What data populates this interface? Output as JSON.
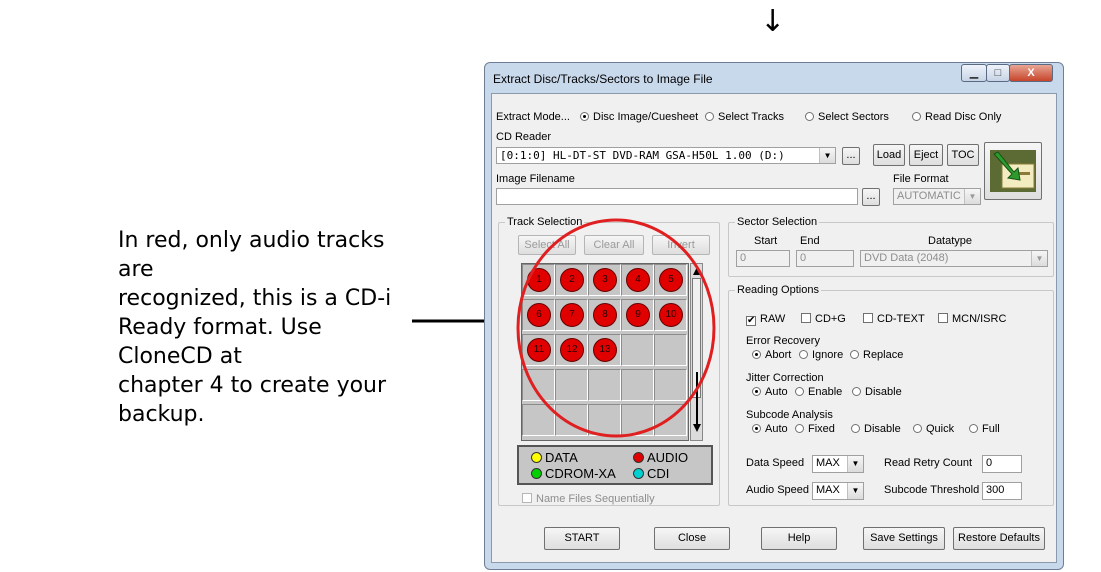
{
  "annotation": {
    "text": "In red, only audio tracks are\nrecognized, this is a CD-i\nReady format. Use CloneCD at\nchapter 4 to create your\nbackup.",
    "arrow_down": "↓"
  },
  "window": {
    "title": "Extract Disc/Tracks/Sectors to Image File",
    "minimize": "▁",
    "maximize": "□",
    "close": "X"
  },
  "extract_mode": {
    "label": "Extract Mode...",
    "options": [
      "Disc Image/Cuesheet",
      "Select Tracks",
      "Select Sectors",
      "Read Disc Only"
    ],
    "selected": "Disc Image/Cuesheet"
  },
  "cd_reader": {
    "label": "CD Reader",
    "value": "[0:1:0] HL-DT-ST DVD-RAM GSA-H50L 1.00 (D:)",
    "browse": "...",
    "load": "Load",
    "eject": "Eject",
    "toc": "TOC"
  },
  "image_filename": {
    "label": "Image Filename",
    "value": "",
    "browse": "..."
  },
  "file_format": {
    "label": "File Format",
    "value": "AUTOMATIC"
  },
  "track_selection": {
    "title": "Track Selection",
    "select_all": "Select All",
    "clear_all": "Clear All",
    "invert": "Invert",
    "tracks": [
      "1",
      "2",
      "3",
      "4",
      "5",
      "6",
      "7",
      "8",
      "9",
      "10",
      "11",
      "12",
      "13"
    ],
    "legend": {
      "data": "DATA",
      "audio": "AUDIO",
      "cdrom_xa": "CDROM-XA",
      "cdi": "CDI"
    },
    "colors": {
      "data": "#ffff00",
      "audio": "#e00000",
      "cdrom_xa": "#00d000",
      "cdi": "#00d0d0"
    },
    "name_files_sequentially": "Name Files Sequentially"
  },
  "sector_selection": {
    "title": "Sector Selection",
    "start_label": "Start",
    "end_label": "End",
    "datatype_label": "Datatype",
    "start_value": "0",
    "end_value": "0",
    "datatype_value": "DVD Data (2048)"
  },
  "reading_options": {
    "title": "Reading Options",
    "raw": "RAW",
    "cdg": "CD+G",
    "cdtext": "CD-TEXT",
    "mcn": "MCN/ISRC",
    "raw_checked": "✔",
    "error_recovery": {
      "label": "Error Recovery",
      "options": [
        "Abort",
        "Ignore",
        "Replace"
      ]
    },
    "jitter_correction": {
      "label": "Jitter Correction",
      "options": [
        "Auto",
        "Enable",
        "Disable"
      ]
    },
    "subcode_analysis": {
      "label": "Subcode Analysis",
      "options": [
        "Auto",
        "Fixed",
        "Disable",
        "Quick",
        "Full"
      ]
    },
    "data_speed_label": "Data Speed",
    "data_speed_value": "MAX",
    "audio_speed_label": "Audio Speed",
    "audio_speed_value": "MAX",
    "retry_label": "Read Retry Count",
    "retry_value": "0",
    "subcode_threshold_label": "Subcode Threshold",
    "subcode_threshold_value": "300"
  },
  "footer": {
    "start": "START",
    "close": "Close",
    "help": "Help",
    "save": "Save Settings",
    "restore": "Restore Defaults"
  }
}
